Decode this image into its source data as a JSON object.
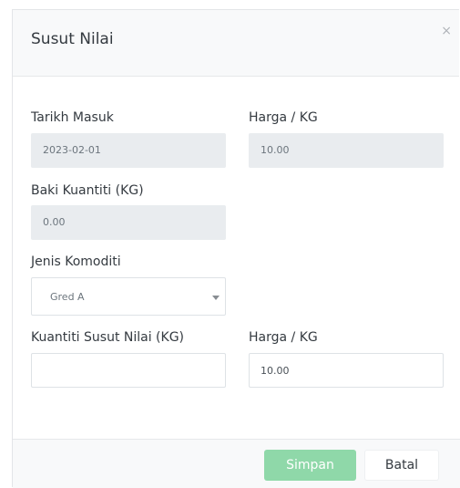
{
  "modal": {
    "title": "Susut Nilai",
    "close_glyph": "×"
  },
  "form": {
    "tarikh_masuk": {
      "label": "Tarikh Masuk",
      "value": "2023-02-01"
    },
    "harga_kg": {
      "label": "Harga / KG",
      "value": "10.00"
    },
    "baki_kuantiti": {
      "label": "Baki Kuantiti (KG)",
      "value": "0.00"
    },
    "jenis_komoditi": {
      "label": "Jenis Komoditi",
      "selected": "Gred A"
    },
    "kuantiti_susut": {
      "label": "Kuantiti Susut Nilai (KG)",
      "value": ""
    },
    "harga_kg_2": {
      "label": "Harga / KG",
      "value": "10.00"
    }
  },
  "footer": {
    "save_label": "Simpan",
    "cancel_label": "Batal"
  },
  "colors": {
    "save_button": "#8fd8a9",
    "header_bg": "#f8f9fa",
    "readonly_bg": "#e9ecef"
  }
}
